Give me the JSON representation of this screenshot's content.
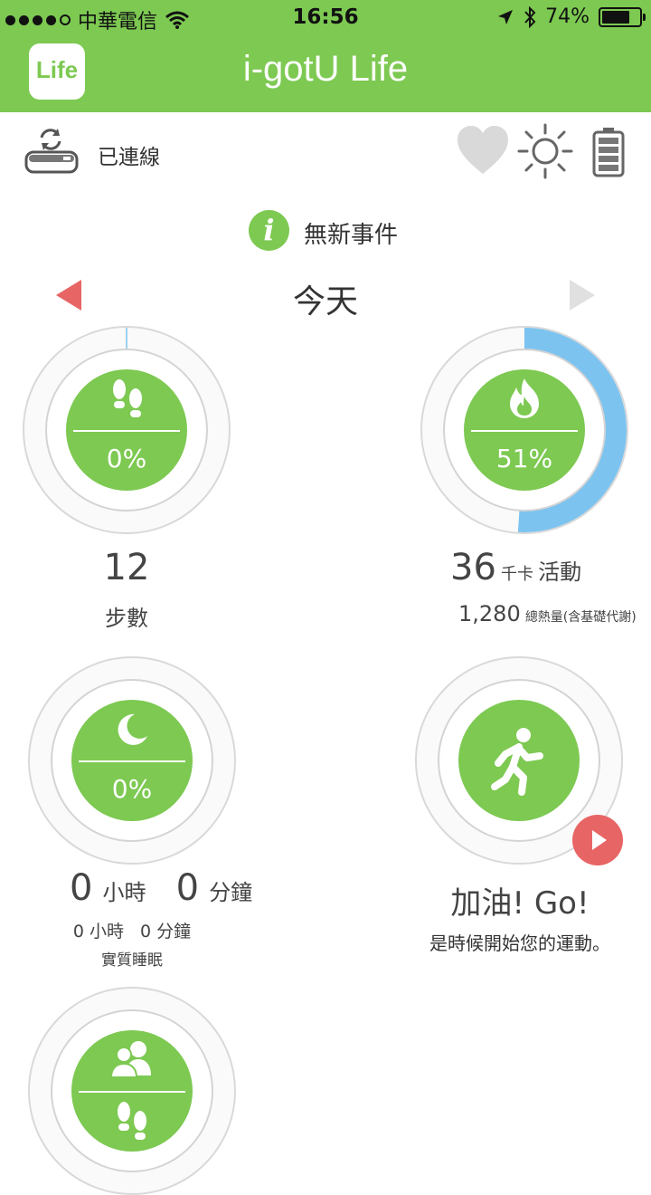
{
  "status_bar": {
    "carrier": "中華電信",
    "time": "16:56",
    "battery_percent": "74%",
    "battery_level": 0.74
  },
  "header": {
    "logo_text": "Life",
    "title": "i-gotU Life"
  },
  "device": {
    "connection_status": "已連線",
    "icons": [
      "sync-device-icon",
      "heart-icon",
      "brightness-icon",
      "battery-icon"
    ]
  },
  "events": {
    "message": "無新事件"
  },
  "navigation": {
    "day_label": "今天",
    "prev_arrow_color": "#e86565",
    "next_arrow_color": "#e0e0e0"
  },
  "steps": {
    "percent_label": "0%",
    "progress": 0.0,
    "value": "12",
    "label": "步數"
  },
  "calories": {
    "percent_label": "51%",
    "progress": 0.51,
    "value": "36",
    "unit": "千卡",
    "label": "活動",
    "total": "1,280",
    "total_label": "總熱量(含基礎代謝)"
  },
  "sleep": {
    "percent_label": "0%",
    "hours": "0",
    "hours_unit": "小時",
    "minutes": "0",
    "minutes_unit": "分鐘",
    "detail": "0 小時   0 分鐘",
    "detail_label": "實質睡眠"
  },
  "exercise": {
    "headline": "加油! Go!",
    "message": "是時候開始您的運動。"
  },
  "colors": {
    "brand_green": "#7dc952",
    "progress_blue": "#7cc3f0",
    "accent_red": "#e86565"
  }
}
